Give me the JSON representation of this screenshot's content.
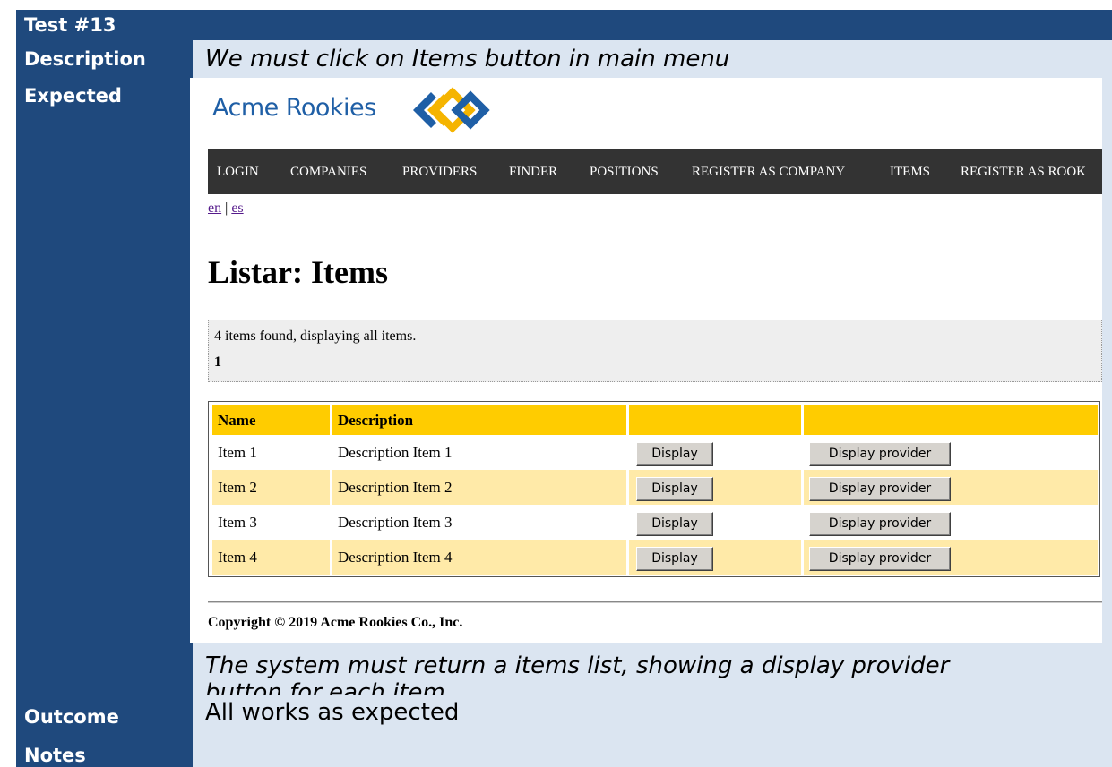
{
  "test_title": "Test #13",
  "rows": {
    "description_label": "Description",
    "description_value": "We must click on Items button in main menu",
    "expected_label": "Expected",
    "expected_value_line1": "The system must return a items list, showing a display provider",
    "expected_value_line2": "button for each item",
    "outcome_label": "Outcome",
    "outcome_value": "All works as expected",
    "notes_label": "Notes",
    "notes_value": ""
  },
  "screenshot": {
    "logo_text": "Acme Rookies",
    "menu": [
      "LOGIN",
      "COMPANIES",
      "PROVIDERS",
      "FINDER",
      "POSITIONS",
      "REGISTER AS COMPANY",
      "ITEMS",
      "REGISTER AS ROOK"
    ],
    "lang_en": "en",
    "lang_sep": "|",
    "lang_es": "es",
    "heading": "Listar: Items",
    "pager_text": "4 items found, displaying all items.",
    "pager_page": "1",
    "table": {
      "headers": [
        "Name",
        "Description",
        "",
        ""
      ],
      "rows": [
        {
          "name": "Item 1",
          "description": "Description Item 1",
          "display": "Display",
          "provider": "Display provider"
        },
        {
          "name": "Item 2",
          "description": "Description Item 2",
          "display": "Display",
          "provider": "Display provider"
        },
        {
          "name": "Item 3",
          "description": "Description Item 3",
          "display": "Display",
          "provider": "Display provider"
        },
        {
          "name": "Item 4",
          "description": "Description Item 4",
          "display": "Display",
          "provider": "Display provider"
        }
      ]
    },
    "copyright": "Copyright © 2019 Acme Rookies Co., Inc."
  },
  "colors": {
    "label_bg": "#1f497d",
    "value_bg": "#dbe5f1",
    "header_yellow": "#ffcc00",
    "row_alt": "#ffeaa8",
    "menu_bg": "#333333",
    "logo_blue": "#1f5fa6",
    "logo_gold": "#f5b400"
  }
}
